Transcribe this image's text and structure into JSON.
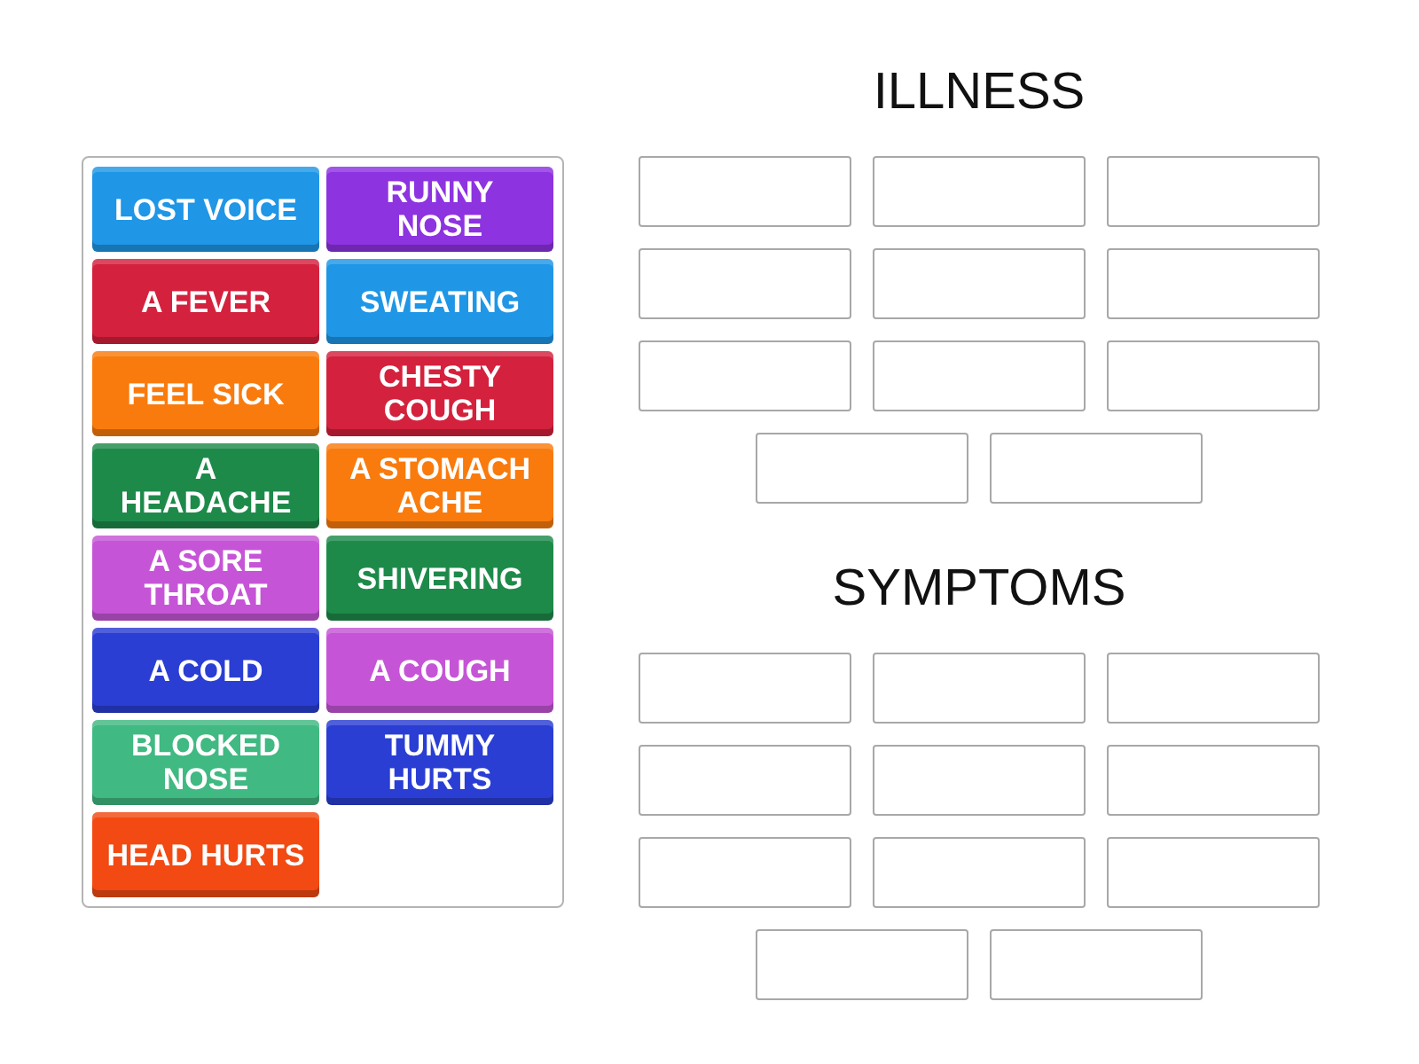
{
  "tiles": [
    {
      "label": "LOST VOICE",
      "color": "#1f96e6"
    },
    {
      "label": "RUNNY\nNOSE",
      "color": "#8d33e0"
    },
    {
      "label": "A FEVER",
      "color": "#d4213d"
    },
    {
      "label": "SWEATING",
      "color": "#1f96e6"
    },
    {
      "label": "FEEL SICK",
      "color": "#f97b0d"
    },
    {
      "label": "CHESTY\nCOUGH",
      "color": "#d4213d"
    },
    {
      "label": "A\nHEADACHE",
      "color": "#1e8a4a"
    },
    {
      "label": "A STOMACH\nACHE",
      "color": "#f97b0d"
    },
    {
      "label": "A SORE\nTHROAT",
      "color": "#c555d6"
    },
    {
      "label": "SHIVERING",
      "color": "#1e8a4a"
    },
    {
      "label": "A COLD",
      "color": "#2a3ed4"
    },
    {
      "label": "A COUGH",
      "color": "#c555d6"
    },
    {
      "label": "BLOCKED\nNOSE",
      "color": "#40b982"
    },
    {
      "label": "TUMMY\nHURTS",
      "color": "#2a3ed4"
    },
    {
      "label": "HEAD HURTS",
      "color": "#f24a12"
    }
  ],
  "groups": [
    {
      "title": "ILLNESS"
    },
    {
      "title": "SYMPTOMS"
    }
  ]
}
